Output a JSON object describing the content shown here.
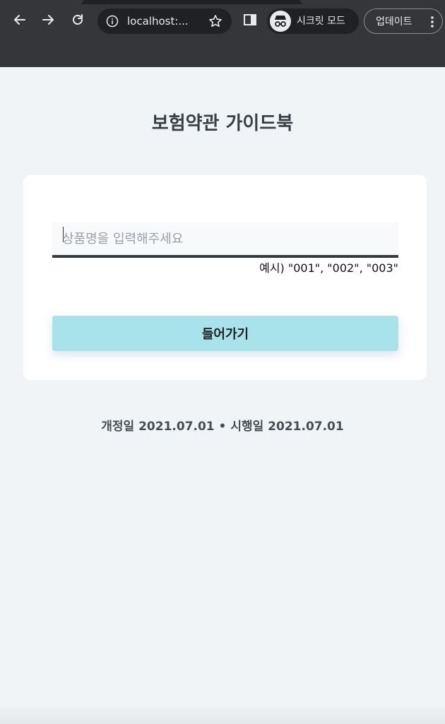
{
  "browser": {
    "url": "localhost:...",
    "incognito_label": "시크릿 모드",
    "update_label": "업데이트"
  },
  "page": {
    "title": "보험약관 가이드북",
    "search": {
      "placeholder": "상품명을 입력해주세요",
      "value": "",
      "hint": "예시) \"001\", \"002\", \"003\""
    },
    "enter_button": "들어가기",
    "dates": "개정일 2021.07.01 • 시행일 2021.07.01"
  },
  "colors": {
    "chrome_bg": "#35363a",
    "page_bg": "#f1f4f7",
    "button_bg": "#a8e2ea",
    "input_border": "#343a40"
  }
}
